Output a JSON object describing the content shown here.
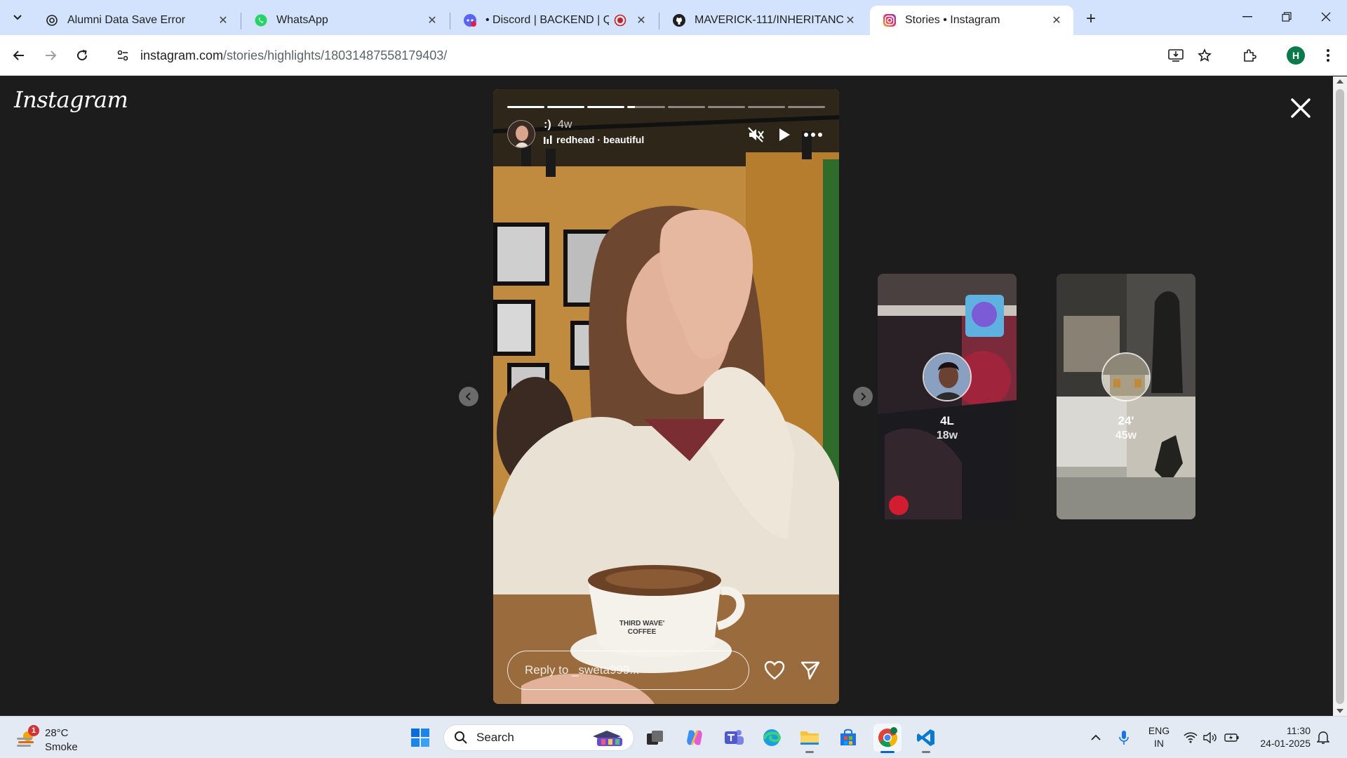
{
  "browser": {
    "tabs": [
      {
        "title": "Alumni Data Save Error",
        "active": false
      },
      {
        "title": "WhatsApp",
        "active": false
      },
      {
        "title": "• Discord | BACKEND | QWE",
        "active": false
      },
      {
        "title": "MAVERICK-111/INHERITANCE",
        "active": false
      },
      {
        "title": "Stories • Instagram",
        "active": true
      }
    ],
    "url_host": "instagram.com",
    "url_path": "/stories/highlights/18031487558179403/",
    "profile_initial": "H"
  },
  "instagram": {
    "logo_text": "Instagram",
    "story": {
      "username": ":)",
      "time_ago": "4w",
      "music": "redhead · beautiful",
      "progress_segments": 8,
      "current_segment": 4,
      "current_progress": 0.2,
      "cup_text_1": "THIRD WAVE'",
      "cup_text_2": "COFFEE",
      "reply_placeholder": "Reply to _sweta999..."
    },
    "previews": [
      {
        "name": "4L",
        "time": "18w"
      },
      {
        "name": "24'",
        "time": "45w"
      }
    ]
  },
  "taskbar": {
    "weather_badge": "1",
    "temperature": "28°C",
    "condition": "Smoke",
    "search_label": "Search",
    "lang_line1": "ENG",
    "lang_line2": "IN",
    "time": "11:30",
    "date": "24-01-2025"
  }
}
